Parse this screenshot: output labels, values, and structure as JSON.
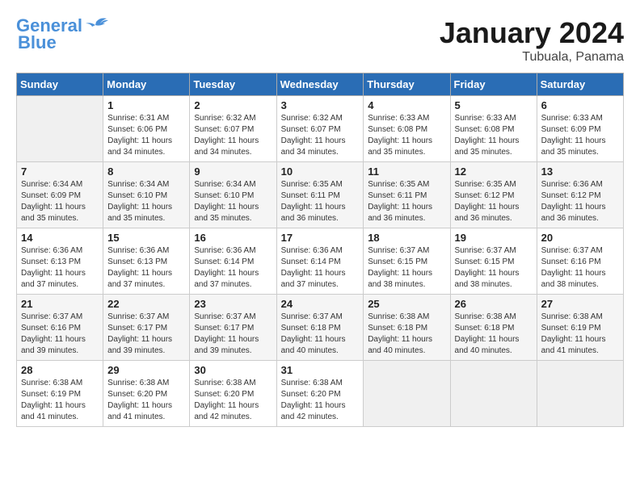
{
  "header": {
    "logo_line1": "General",
    "logo_line2": "Blue",
    "title": "January 2024",
    "subtitle": "Tubuala, Panama"
  },
  "calendar": {
    "days_of_week": [
      "Sunday",
      "Monday",
      "Tuesday",
      "Wednesday",
      "Thursday",
      "Friday",
      "Saturday"
    ],
    "weeks": [
      [
        {
          "num": "",
          "empty": true
        },
        {
          "num": "1",
          "sunrise": "Sunrise: 6:31 AM",
          "sunset": "Sunset: 6:06 PM",
          "daylight": "Daylight: 11 hours and 34 minutes."
        },
        {
          "num": "2",
          "sunrise": "Sunrise: 6:32 AM",
          "sunset": "Sunset: 6:07 PM",
          "daylight": "Daylight: 11 hours and 34 minutes."
        },
        {
          "num": "3",
          "sunrise": "Sunrise: 6:32 AM",
          "sunset": "Sunset: 6:07 PM",
          "daylight": "Daylight: 11 hours and 34 minutes."
        },
        {
          "num": "4",
          "sunrise": "Sunrise: 6:33 AM",
          "sunset": "Sunset: 6:08 PM",
          "daylight": "Daylight: 11 hours and 35 minutes."
        },
        {
          "num": "5",
          "sunrise": "Sunrise: 6:33 AM",
          "sunset": "Sunset: 6:08 PM",
          "daylight": "Daylight: 11 hours and 35 minutes."
        },
        {
          "num": "6",
          "sunrise": "Sunrise: 6:33 AM",
          "sunset": "Sunset: 6:09 PM",
          "daylight": "Daylight: 11 hours and 35 minutes."
        }
      ],
      [
        {
          "num": "7",
          "sunrise": "Sunrise: 6:34 AM",
          "sunset": "Sunset: 6:09 PM",
          "daylight": "Daylight: 11 hours and 35 minutes."
        },
        {
          "num": "8",
          "sunrise": "Sunrise: 6:34 AM",
          "sunset": "Sunset: 6:10 PM",
          "daylight": "Daylight: 11 hours and 35 minutes."
        },
        {
          "num": "9",
          "sunrise": "Sunrise: 6:34 AM",
          "sunset": "Sunset: 6:10 PM",
          "daylight": "Daylight: 11 hours and 35 minutes."
        },
        {
          "num": "10",
          "sunrise": "Sunrise: 6:35 AM",
          "sunset": "Sunset: 6:11 PM",
          "daylight": "Daylight: 11 hours and 36 minutes."
        },
        {
          "num": "11",
          "sunrise": "Sunrise: 6:35 AM",
          "sunset": "Sunset: 6:11 PM",
          "daylight": "Daylight: 11 hours and 36 minutes."
        },
        {
          "num": "12",
          "sunrise": "Sunrise: 6:35 AM",
          "sunset": "Sunset: 6:12 PM",
          "daylight": "Daylight: 11 hours and 36 minutes."
        },
        {
          "num": "13",
          "sunrise": "Sunrise: 6:36 AM",
          "sunset": "Sunset: 6:12 PM",
          "daylight": "Daylight: 11 hours and 36 minutes."
        }
      ],
      [
        {
          "num": "14",
          "sunrise": "Sunrise: 6:36 AM",
          "sunset": "Sunset: 6:13 PM",
          "daylight": "Daylight: 11 hours and 37 minutes."
        },
        {
          "num": "15",
          "sunrise": "Sunrise: 6:36 AM",
          "sunset": "Sunset: 6:13 PM",
          "daylight": "Daylight: 11 hours and 37 minutes."
        },
        {
          "num": "16",
          "sunrise": "Sunrise: 6:36 AM",
          "sunset": "Sunset: 6:14 PM",
          "daylight": "Daylight: 11 hours and 37 minutes."
        },
        {
          "num": "17",
          "sunrise": "Sunrise: 6:36 AM",
          "sunset": "Sunset: 6:14 PM",
          "daylight": "Daylight: 11 hours and 37 minutes."
        },
        {
          "num": "18",
          "sunrise": "Sunrise: 6:37 AM",
          "sunset": "Sunset: 6:15 PM",
          "daylight": "Daylight: 11 hours and 38 minutes."
        },
        {
          "num": "19",
          "sunrise": "Sunrise: 6:37 AM",
          "sunset": "Sunset: 6:15 PM",
          "daylight": "Daylight: 11 hours and 38 minutes."
        },
        {
          "num": "20",
          "sunrise": "Sunrise: 6:37 AM",
          "sunset": "Sunset: 6:16 PM",
          "daylight": "Daylight: 11 hours and 38 minutes."
        }
      ],
      [
        {
          "num": "21",
          "sunrise": "Sunrise: 6:37 AM",
          "sunset": "Sunset: 6:16 PM",
          "daylight": "Daylight: 11 hours and 39 minutes."
        },
        {
          "num": "22",
          "sunrise": "Sunrise: 6:37 AM",
          "sunset": "Sunset: 6:17 PM",
          "daylight": "Daylight: 11 hours and 39 minutes."
        },
        {
          "num": "23",
          "sunrise": "Sunrise: 6:37 AM",
          "sunset": "Sunset: 6:17 PM",
          "daylight": "Daylight: 11 hours and 39 minutes."
        },
        {
          "num": "24",
          "sunrise": "Sunrise: 6:37 AM",
          "sunset": "Sunset: 6:18 PM",
          "daylight": "Daylight: 11 hours and 40 minutes."
        },
        {
          "num": "25",
          "sunrise": "Sunrise: 6:38 AM",
          "sunset": "Sunset: 6:18 PM",
          "daylight": "Daylight: 11 hours and 40 minutes."
        },
        {
          "num": "26",
          "sunrise": "Sunrise: 6:38 AM",
          "sunset": "Sunset: 6:18 PM",
          "daylight": "Daylight: 11 hours and 40 minutes."
        },
        {
          "num": "27",
          "sunrise": "Sunrise: 6:38 AM",
          "sunset": "Sunset: 6:19 PM",
          "daylight": "Daylight: 11 hours and 41 minutes."
        }
      ],
      [
        {
          "num": "28",
          "sunrise": "Sunrise: 6:38 AM",
          "sunset": "Sunset: 6:19 PM",
          "daylight": "Daylight: 11 hours and 41 minutes."
        },
        {
          "num": "29",
          "sunrise": "Sunrise: 6:38 AM",
          "sunset": "Sunset: 6:20 PM",
          "daylight": "Daylight: 11 hours and 41 minutes."
        },
        {
          "num": "30",
          "sunrise": "Sunrise: 6:38 AM",
          "sunset": "Sunset: 6:20 PM",
          "daylight": "Daylight: 11 hours and 42 minutes."
        },
        {
          "num": "31",
          "sunrise": "Sunrise: 6:38 AM",
          "sunset": "Sunset: 6:20 PM",
          "daylight": "Daylight: 11 hours and 42 minutes."
        },
        {
          "num": "",
          "empty": true
        },
        {
          "num": "",
          "empty": true
        },
        {
          "num": "",
          "empty": true
        }
      ]
    ]
  }
}
